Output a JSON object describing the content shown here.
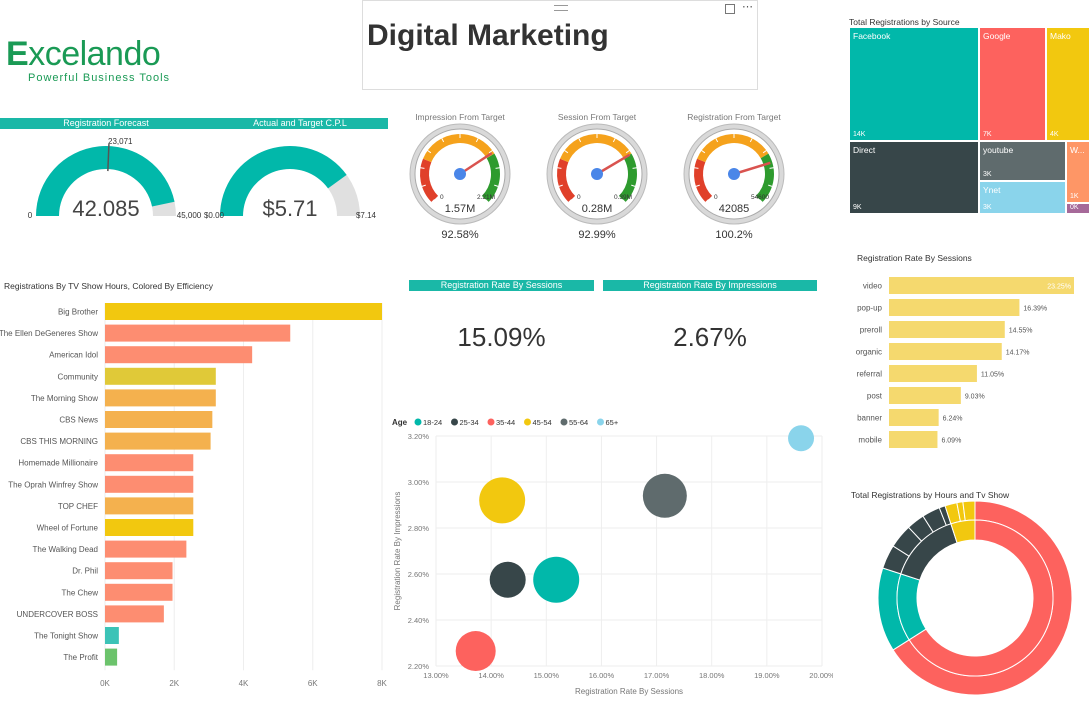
{
  "logo": {
    "name_pre": "E",
    "name_main": "xcelando",
    "tagline": "Powerful Business Tools"
  },
  "title": {
    "text": "Digital Marketing"
  },
  "gauges": {
    "forecast": {
      "header": "Registration Forecast",
      "value": "42.085",
      "target": "23,071",
      "min": "0",
      "max": "45,000",
      "fraction": 0.935,
      "target_fraction": 0.513
    },
    "cpl": {
      "header": "Actual and Target C.P.L",
      "value": "$5.71",
      "min": "$0.00",
      "max": "$7.14",
      "fraction": 0.8
    }
  },
  "dials": [
    {
      "title": "Impression From Target",
      "min": "0",
      "max": "2.21M",
      "value": "1.57M",
      "pct": "92.58%",
      "needle": 0.71
    },
    {
      "title": "Session From Target",
      "min": "0",
      "max": "0.39M",
      "value": "0.28M",
      "pct": "92.99%",
      "needle": 0.72
    },
    {
      "title": "Registration From Target",
      "min": "0",
      "max": "54600",
      "value": "42085",
      "pct": "100.2%",
      "needle": 0.77
    }
  ],
  "treemap": {
    "title": "Total Registrations by Source",
    "cells": [
      {
        "name": "Facebook",
        "value": "14K",
        "color": "#01b8aa"
      },
      {
        "name": "Google",
        "value": "7K",
        "color": "#fd625e"
      },
      {
        "name": "Mako",
        "value": "4K",
        "color": "#f2c80f"
      },
      {
        "name": "Direct",
        "value": "9K",
        "color": "#374649"
      },
      {
        "name": "youtube",
        "value": "3K",
        "color": "#5f6b6d"
      },
      {
        "name": "Ynet",
        "value": "3K",
        "color": "#8ad4eb"
      },
      {
        "name": "W...",
        "value": "1K",
        "color": "#fe9666"
      },
      {
        "name": "",
        "value": "0K",
        "color": "#a66999"
      }
    ]
  },
  "tvshows": {
    "title": "Registrations By TV Show Hours, Colored By Efficiency",
    "chart_data": {
      "type": "bar",
      "categories": [
        "Big Brother",
        "The Ellen DeGeneres Show",
        "American Idol",
        "Community",
        "The Morning Show",
        "CBS News",
        "CBS THIS MORNING",
        "Homemade Millionaire",
        "The Oprah Winfrey Show",
        "TOP CHEF",
        "Wheel of Fortune",
        "The Walking Dead",
        "Dr. Phil",
        "The Chew",
        "UNDERCOVER BOSS",
        "The Tonight Show",
        "The Profit"
      ],
      "values": [
        8000,
        5350,
        4250,
        3200,
        3200,
        3100,
        3050,
        2550,
        2550,
        2550,
        2550,
        2350,
        1950,
        1950,
        1700,
        400,
        350
      ],
      "colors": [
        "#f2c80f",
        "#fd8d71",
        "#fd8d71",
        "#e0c938",
        "#f4b14e",
        "#f4b14e",
        "#f4b14e",
        "#fd8d71",
        "#fd8d71",
        "#f4b14e",
        "#f2c80f",
        "#fd8d71",
        "#fd8d71",
        "#fd8d71",
        "#fd8d71",
        "#3cc3b7",
        "#6cc36c"
      ],
      "xticks": [
        "0K",
        "2K",
        "4K",
        "6K",
        "8K"
      ],
      "xlim": [
        0,
        8000
      ]
    }
  },
  "kpis": {
    "sessions": {
      "header": "Registration Rate By Sessions",
      "value": "15.09%"
    },
    "impressions": {
      "header": "Registration Rate By Impressions",
      "value": "2.67%"
    }
  },
  "scatter": {
    "legend_title": "Age",
    "chart_data": {
      "type": "scatter",
      "xlabel": "Registration Rate By Sessions",
      "ylabel": "Registration Rate By Impressions",
      "xlim": [
        13,
        20
      ],
      "ylim": [
        2.2,
        3.2
      ],
      "xticks": [
        "13.00%",
        "14.00%",
        "15.00%",
        "16.00%",
        "17.00%",
        "18.00%",
        "19.00%",
        "20.00%"
      ],
      "yticks": [
        "2.20%",
        "2.40%",
        "2.60%",
        "2.80%",
        "3.00%",
        "3.20%"
      ],
      "series": [
        {
          "name": "18-24",
          "color": "#01b8aa",
          "x": 15.18,
          "y": 2.575,
          "r": 23
        },
        {
          "name": "25-34",
          "color": "#374649",
          "x": 14.3,
          "y": 2.575,
          "r": 18
        },
        {
          "name": "35-44",
          "color": "#fd625e",
          "x": 13.72,
          "y": 2.265,
          "r": 20
        },
        {
          "name": "45-54",
          "color": "#f2c80f",
          "x": 14.2,
          "y": 2.92,
          "r": 23
        },
        {
          "name": "55-64",
          "color": "#5f6b6d",
          "x": 17.15,
          "y": 2.94,
          "r": 22
        },
        {
          "name": "65+",
          "color": "#8ad4eb",
          "x": 19.62,
          "y": 3.19,
          "r": 13
        }
      ]
    }
  },
  "rate_sessions": {
    "title": "Registration Rate By Sessions",
    "chart_data": {
      "type": "bar",
      "categories": [
        "video",
        "pop-up",
        "preroll",
        "organic",
        "referral",
        "post",
        "banner",
        "mobile"
      ],
      "values": [
        23.25,
        16.39,
        14.55,
        14.17,
        11.05,
        9.03,
        6.24,
        6.09
      ],
      "labels": [
        "23.25%",
        "16.39%",
        "14.55%",
        "14.17%",
        "11.05%",
        "9.03%",
        "6.24%",
        "6.09%"
      ],
      "color": "#f5d96e"
    }
  },
  "donut": {
    "title": "Total Registrations by Hours and Tv Show",
    "chart_data": {
      "type": "pie",
      "inner": [
        {
          "value": 0.66,
          "color": "#fd625e"
        },
        {
          "value": 0.14,
          "color": "#01b8aa"
        },
        {
          "value": 0.15,
          "color": "#374649"
        },
        {
          "value": 0.05,
          "color": "#f2c80f"
        }
      ],
      "outer": [
        {
          "value": 0.66,
          "color": "#fd625e"
        },
        {
          "value": 0.14,
          "color": "#01b8aa"
        },
        {
          "value": 0.04,
          "color": "#374649"
        },
        {
          "value": 0.04,
          "color": "#374649"
        },
        {
          "value": 0.03,
          "color": "#374649"
        },
        {
          "value": 0.03,
          "color": "#374649"
        },
        {
          "value": 0.01,
          "color": "#374649"
        },
        {
          "value": 0.02,
          "color": "#f2c80f"
        },
        {
          "value": 0.01,
          "color": "#f2c80f"
        },
        {
          "value": 0.02,
          "color": "#f2c80f"
        }
      ]
    }
  }
}
